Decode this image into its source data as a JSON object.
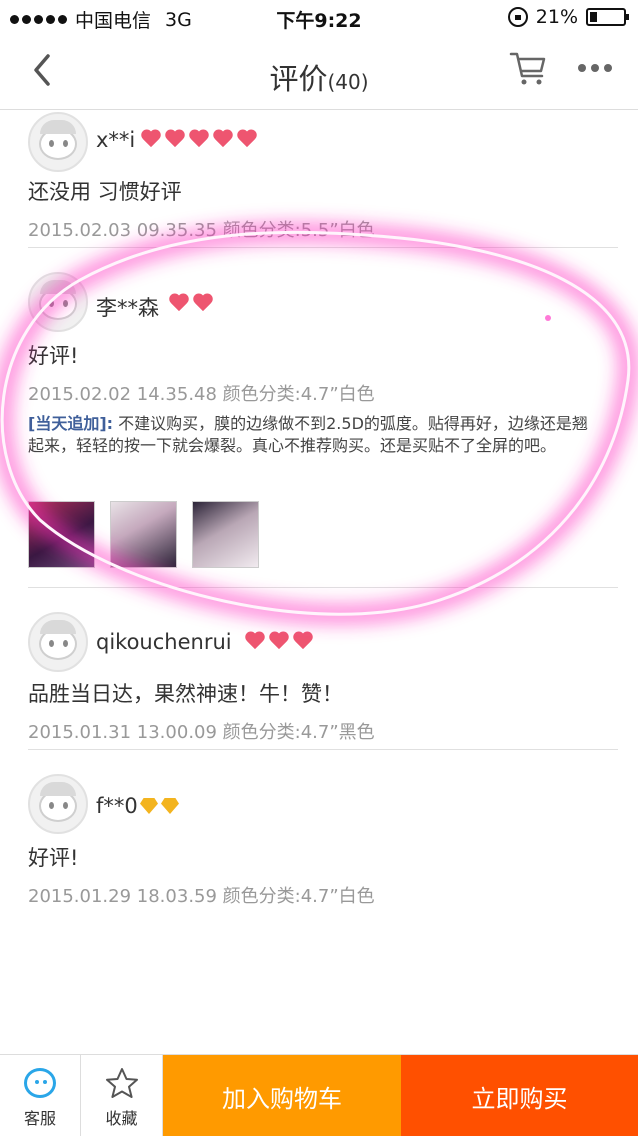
{
  "status_bar": {
    "carrier": "中国电信",
    "network": "3G",
    "time": "下午9:22",
    "battery": "21%"
  },
  "nav": {
    "title": "评价",
    "count": "(40)",
    "icons": [
      "back-arrow-icon",
      "cart-icon",
      "more-icon"
    ]
  },
  "reviews": [
    {
      "username": "x**i",
      "badge_type": "heart",
      "badge_count": 5,
      "comment": "还没用 习惯好评",
      "meta": "2015.02.03 09.35.35 颜色分类:5.5”白色"
    },
    {
      "username": "李**森",
      "badge_type": "heart",
      "badge_count": 2,
      "comment": "好评!",
      "meta": "2015.02.02 14.35.48 颜色分类:4.7”白色",
      "followup_tag": "[当天追加]:",
      "followup_text": " 不建议购买，膜的边缘做不到2.5D的弧度。贴得再好，边缘还是翘起来，轻轻的按一下就会爆裂。真心不推荐购买。还是买贴不了全屏的吧。",
      "images": 3
    },
    {
      "username": "qikouchenrui",
      "badge_type": "heart",
      "badge_count": 3,
      "comment": "品胜当日达，果然神速！牛！赞！",
      "meta": "2015.01.31 13.00.09 颜色分类:4.7”黑色"
    },
    {
      "username": "f**0",
      "badge_type": "diamond",
      "badge_count": 2,
      "comment": "好评!",
      "meta": "2015.01.29 18.03.59 颜色分类:4.7”白色"
    }
  ],
  "bottom_bar": {
    "service_label": "客服",
    "favorite_label": "收藏",
    "add_to_cart": "加入购物车",
    "buy_now": "立即购买"
  },
  "colors": {
    "accent_orange": "#ff9a00",
    "accent_red": "#ff5000",
    "highlight_pink": "#ff3ec8",
    "heart_red": "#ee5570",
    "diamond_gold": "#f3b41f"
  }
}
